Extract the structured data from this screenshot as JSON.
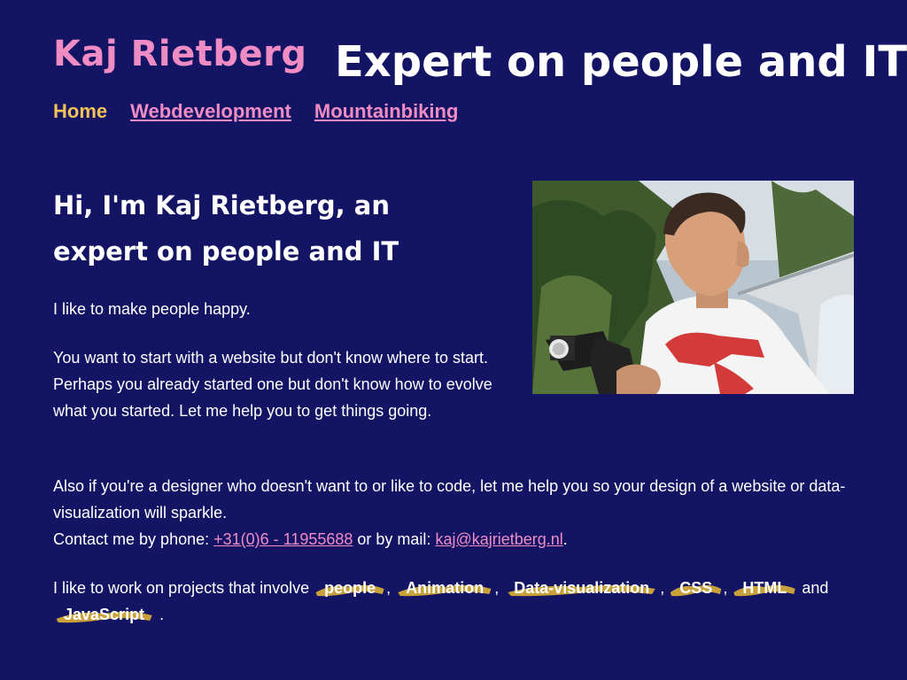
{
  "header": {
    "site_name": "Kaj Rietberg",
    "tagline": "Expert on people and IT"
  },
  "nav": {
    "items": [
      {
        "label": "Home",
        "current": true
      },
      {
        "label": "Webdevelopment"
      },
      {
        "label": "Mountainbiking"
      }
    ]
  },
  "intro": {
    "heading": "Hi, I'm Kaj Rietberg, an expert on people and IT",
    "p1": "I like to make people happy.",
    "p2": "You want to start with a website but don't know where to start. Perhaps you already started one but don't know how to evolve what you started. Let me help you to get things going.",
    "p3": "Also if you're a designer who doesn't want to or like to code, let me help you so your design of a website or data-visualization will sparkle.",
    "contact_phone_prefix": "Contact me by phone: ",
    "phone": "+31(0)6 - 11955688",
    "contact_mail_prefix": " or by mail: ",
    "email": "kaj@kajrietberg.nl",
    "contact_end": "."
  },
  "skills": {
    "prefix": "I like to work on projects that involve ",
    "tags": [
      "people",
      "Animation",
      "Data-visualization",
      "CSS",
      "HTML",
      "JavaScript"
    ],
    "comma": ",",
    "and": "and",
    "end": "."
  },
  "photo": {
    "alt": "Portrait of Kaj Rietberg holding a camera"
  },
  "colors": {
    "background": "#141464",
    "accent_pink": "#f08cc4",
    "accent_yellow": "#f5c257",
    "highlight_gold": "#c9a13a"
  }
}
